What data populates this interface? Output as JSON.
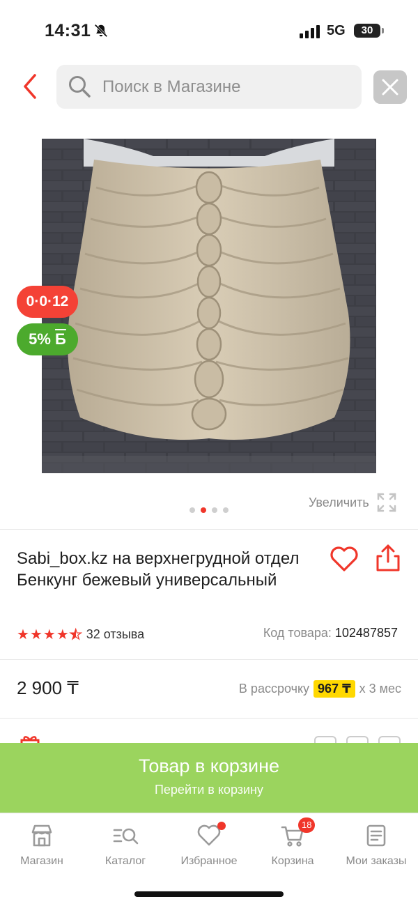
{
  "status_bar": {
    "time": "14:31",
    "network": "5G",
    "battery": "30"
  },
  "search": {
    "placeholder": "Поиск в Магазине"
  },
  "badges": {
    "timer": "0·0·12",
    "bonus_percent": "5%",
    "bonus_symbol": "Б"
  },
  "gallery": {
    "zoom_label": "Увеличить",
    "total_images": 4,
    "active_index": 1
  },
  "product": {
    "title": "Sabi_box.kz на верхнегрудной отдел Бенкунг бежевый универсальный",
    "rating_stars": 4.5,
    "reviews": "32 отзыва",
    "code_label": "Код товара:",
    "code_value": "102487857",
    "price": "2 900 ₸",
    "installment_label": "В рассрочку",
    "installment_amount": "967 ₸",
    "installment_term": "x 3 мес"
  },
  "cart_banner": {
    "title": "Товар в корзине",
    "subtitle": "Перейти в корзину",
    "color": "#9bd45e"
  },
  "tabs": [
    {
      "label": "Магазин",
      "icon": "store-icon"
    },
    {
      "label": "Каталог",
      "icon": "catalog-search-icon"
    },
    {
      "label": "Избранное",
      "icon": "heart-icon"
    },
    {
      "label": "Корзина",
      "icon": "cart-icon",
      "badge": "18"
    },
    {
      "label": "Мои заказы",
      "icon": "orders-icon"
    }
  ],
  "colors": {
    "accent": "#f0362a",
    "bonus_green": "#4caa2d",
    "installment_highlight": "#ffd800"
  }
}
